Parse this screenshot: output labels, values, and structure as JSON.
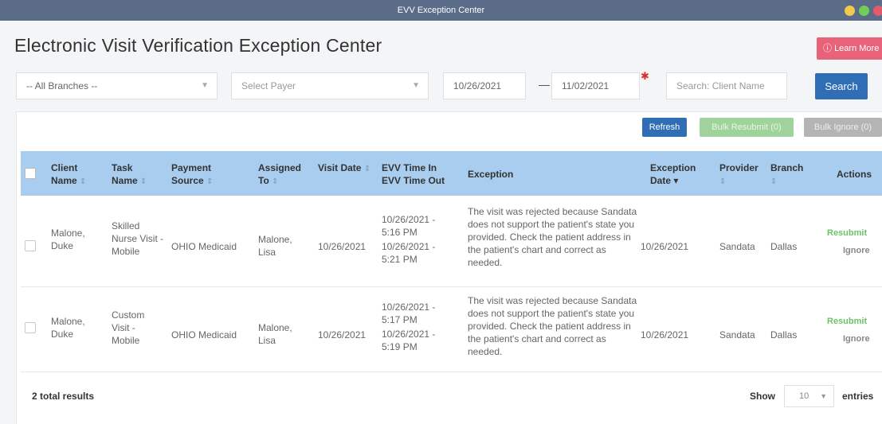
{
  "window": {
    "title": "EVV Exception Center"
  },
  "page_title": "Electronic Visit Verification Exception Center",
  "learn_more_label": "Learn More",
  "filters": {
    "branch": "-- All Branches --",
    "payer_placeholder": "Select Payer",
    "date_from": "10/26/2021",
    "date_to": "11/02/2021",
    "search_placeholder": "Search: Client Name",
    "search_label": "Search"
  },
  "toolbar": {
    "refresh": "Refresh",
    "bulk_resubmit": "Bulk Resubmit (0)",
    "bulk_ignore": "Bulk Ignore (0)"
  },
  "columns": {
    "client_name": "Client Name",
    "task_name": "Task Name",
    "payment_source": "Payment Source",
    "assigned_to": "Assigned To",
    "visit_date": "Visit Date",
    "evv_time": "EVV Time In EVV Time Out",
    "exception": "Exception",
    "exception_date": "Exception Date",
    "provider": "Provider",
    "branch": "Branch",
    "actions": "Actions"
  },
  "rows": [
    {
      "client_name": "Malone, Duke",
      "task_name": "Skilled Nurse Visit - Mobile",
      "payment_source": "OHIO Medicaid",
      "assigned_to": "Malone, Lisa",
      "visit_date": "10/26/2021",
      "evv_in": "10/26/2021 - 5:16 PM",
      "evv_out": "10/26/2021 - 5:21 PM",
      "exception": "The visit was rejected because Sandata does not support the patient's state you provided. Check the patient address in the patient's chart and correct as needed.",
      "exception_date": "10/26/2021",
      "provider": "Sandata",
      "branch": "Dallas",
      "resubmit": "Resubmit",
      "ignore": "Ignore"
    },
    {
      "client_name": "Malone, Duke",
      "task_name": "Custom Visit - Mobile",
      "payment_source": "OHIO Medicaid",
      "assigned_to": "Malone, Lisa",
      "visit_date": "10/26/2021",
      "evv_in": "10/26/2021 - 5:17 PM",
      "evv_out": "10/26/2021 - 5:19 PM",
      "exception": "The visit was rejected because Sandata does not support the patient's state you provided. Check the patient address in the patient's chart and correct as needed.",
      "exception_date": "10/26/2021",
      "provider": "Sandata",
      "branch": "Dallas",
      "resubmit": "Resubmit",
      "ignore": "Ignore"
    }
  ],
  "footer": {
    "total": "2 total results",
    "show": "Show",
    "entries_value": "10",
    "entries": "entries"
  },
  "colors": {
    "titlebar": "#5a6c88",
    "primary": "#2f6db5",
    "header_row": "#a9cdee",
    "resubmit": "#6cc26a",
    "learn_more": "#e8637a"
  }
}
